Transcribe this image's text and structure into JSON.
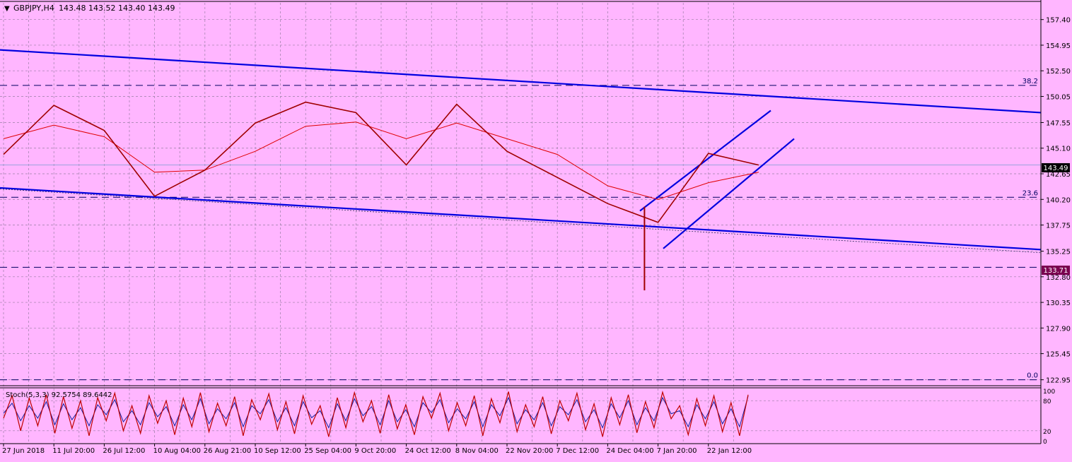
{
  "header": {
    "symbol": "GBPJPY,H4",
    "ohlc": "143.48 143.52 143.40 143.49"
  },
  "colors": {
    "background": "#ffb6ff",
    "grid": "#9a7fa5",
    "candle": "#a00000",
    "ma": "#e00000",
    "trendline": "#0000e0",
    "level": "#000060",
    "price_tag": "#000000",
    "support_tag": "#7a0050",
    "stoch_main": "#c00000",
    "stoch_signal": "#1020a0"
  },
  "chart_data": {
    "type": "line",
    "series": [
      {
        "x": [
          "27 Jun 2018",
          "11 Jul 20:00",
          "26 Jul 12:00",
          "10 Aug 04:00",
          "26 Aug 21:00",
          "10 Sep 12:00",
          "25 Sep 04:00",
          "9 Oct 20:00",
          "24 Oct 12:00",
          "8 Nov 04:00",
          "22 Nov 20:00",
          "7 Dec 12:00",
          "24 Dec 04:00",
          "7 Jan 20:00",
          "22 Jan 12:00",
          "29 Jan"
        ],
        "values": [
          144.5,
          149.2,
          146.8,
          140.5,
          143.0,
          147.5,
          149.5,
          148.5,
          143.5,
          149.3,
          144.8,
          142.3,
          139.8,
          138.0,
          144.6,
          143.49
        ]
      },
      {
        "x": [
          "27 Jun 2018",
          "11 Jul 20:00",
          "26 Jul 12:00",
          "10 Aug 04:00",
          "26 Aug 21:00",
          "10 Sep 12:00",
          "25 Sep 04:00",
          "9 Oct 20:00",
          "24 Oct 12:00",
          "8 Nov 04:00",
          "22 Nov 20:00",
          "7 Dec 12:00",
          "24 Dec 04:00",
          "7 Jan 20:00",
          "22 Jan 12:00",
          "29 Jan"
        ],
        "values": [
          146.0,
          147.3,
          146.2,
          142.8,
          143.0,
          144.8,
          147.2,
          147.6,
          146.0,
          147.5,
          146.0,
          144.5,
          141.5,
          140.2,
          141.8,
          142.8
        ]
      }
    ],
    "y_ticks": [
      "157.40",
      "154.95",
      "152.50",
      "150.05",
      "147.55",
      "145.10",
      "142.65",
      "140.20",
      "137.75",
      "135.25",
      "132.80",
      "130.35",
      "127.90",
      "125.45",
      "122.95"
    ],
    "ylim": [
      122.45,
      159.0
    ],
    "x_ticks": [
      "27 Jun 2018",
      "11 Jul 20:00",
      "26 Jul 12:00",
      "10 Aug 04:00",
      "26 Aug 21:00",
      "10 Sep 12:00",
      "25 Sep 04:00",
      "9 Oct 20:00",
      "24 Oct 12:00",
      "8 Nov 04:00",
      "22 Nov 20:00",
      "7 Dec 12:00",
      "24 Dec 04:00",
      "7 Jan 20:00",
      "22 Jan 12:00"
    ],
    "current_price": "143.49",
    "support_level": "133.71",
    "fib_levels": [
      {
        "label": "38.2",
        "value": 151.1
      },
      {
        "label": "23.6",
        "value": 140.4
      },
      {
        "label": "0.0",
        "value": 122.95
      }
    ],
    "flash_low": 131.5,
    "grid": true
  },
  "stoch": {
    "label": "Stoch(5,3,3) 92.5754 89.6442",
    "scale": [
      "100",
      "80",
      "20",
      "0"
    ],
    "main": [
      45,
      90,
      20,
      85,
      30,
      92,
      15,
      88,
      25,
      80,
      10,
      86,
      40,
      95,
      20,
      70,
      15,
      90,
      35,
      80,
      12,
      85,
      28,
      96,
      18,
      75,
      30,
      88,
      10,
      82,
      42,
      94,
      22,
      78,
      14,
      90,
      33,
      70,
      8,
      86,
      26,
      96,
      38,
      80,
      15,
      92,
      24,
      72,
      12,
      88,
      45,
      95,
      20,
      76,
      30,
      90,
      10,
      84,
      36,
      98,
      18,
      72,
      28,
      88,
      14,
      80,
      40,
      95,
      22,
      74,
      8,
      86,
      32,
      92,
      16,
      78,
      26,
      97,
      44,
      70,
      12,
      84,
      30,
      90,
      18,
      76,
      10,
      92
    ],
    "signal": [
      55,
      75,
      40,
      70,
      45,
      78,
      32,
      74,
      42,
      66,
      30,
      72,
      52,
      82,
      38,
      60,
      32,
      76,
      48,
      68,
      30,
      72,
      42,
      84,
      34,
      64,
      44,
      76,
      28,
      70,
      54,
      82,
      38,
      66,
      30,
      78,
      46,
      60,
      26,
      74,
      40,
      84,
      50,
      68,
      32,
      80,
      38,
      62,
      28,
      76,
      56,
      82,
      36,
      64,
      44,
      78,
      28,
      72,
      50,
      86,
      34,
      62,
      42,
      76,
      30,
      68,
      52,
      82,
      38,
      62,
      26,
      74,
      46,
      80,
      32,
      66,
      40,
      86,
      54,
      60,
      28,
      72,
      44,
      78,
      34,
      64,
      28,
      89
    ]
  }
}
